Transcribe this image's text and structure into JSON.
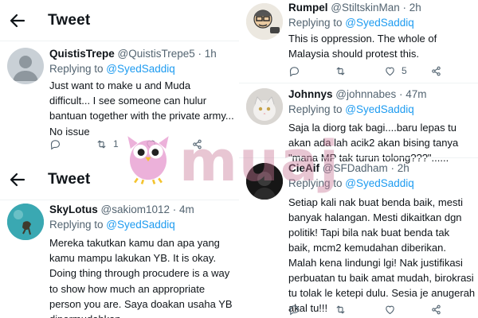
{
  "left_top": {
    "header_title": "Tweet",
    "tweet": {
      "name": "QuistisTrepe",
      "handle": "@QuistisTrepe5 · 1h",
      "replying_prefix": "Replying to ",
      "replying_to": "@SyedSaddiq",
      "text": "Just want to make u and Muda\ndifficult... I see someone can hulur\nbantuan together with the private army...\nNo issue",
      "retweets": "1",
      "likes": ""
    }
  },
  "left_bottom": {
    "header_title": "Tweet",
    "tweet": {
      "name": "SkyLotus",
      "handle": "@sakiom1012 · 4m",
      "replying_prefix": "Replying to ",
      "replying_to": "@SyedSaddiq",
      "text": "Mereka takutkan kamu dan apa yang\nkamu mampu lakukan YB. It is okay.\nDoing thing through procudere is a way\nto show how much an appropriate\nperson you are. Saya doakan usaha YB\ndipermudahkan."
    }
  },
  "right": {
    "tweets": [
      {
        "name": "Rumpel",
        "handle": "@StiltskinMan · 2h",
        "replying_prefix": "Replying to ",
        "replying_to": "@SyedSaddiq",
        "text": "This is oppression. The whole of\nMalaysia should protest this.",
        "likes": "5"
      },
      {
        "name": "Johnnys",
        "handle": "@johnnabes · 47m",
        "replying_prefix": "Replying to ",
        "replying_to": "@SyedSaddiq",
        "text": "Saja la diorg tak bagi....baru lepas tu\nakan ada lah acik2 akan bising tanya\n\"mana MP tak turun tolong???\"......"
      },
      {
        "name": "CieAif",
        "handle": "@SFDadham · 2h",
        "replying_prefix": "Replying to ",
        "replying_to": "@SyedSaddiq",
        "text": "Setiap kali nak buat benda baik, mesti\nbanyak halangan. Mesti dikaitkan dgn\npolitik! Tapi bila nak buat benda tak\nbaik, mcm2 kemudahan diberikan.\nMalah kena lindungi lgi! Nak justifikasi\nperbuatan tu baik amat mudah, birokrasi\ntu tolak le ketepi dulu. Sesia je anugerah\nakal tu!!!"
      }
    ]
  },
  "watermark": {
    "text": "muaj"
  },
  "colors": {
    "mention": "#1d9bf0",
    "muted": "#536471",
    "divider": "#eff3f4"
  },
  "icons": [
    "back-arrow-icon",
    "reply-icon",
    "retweet-icon",
    "like-icon",
    "share-icon"
  ]
}
